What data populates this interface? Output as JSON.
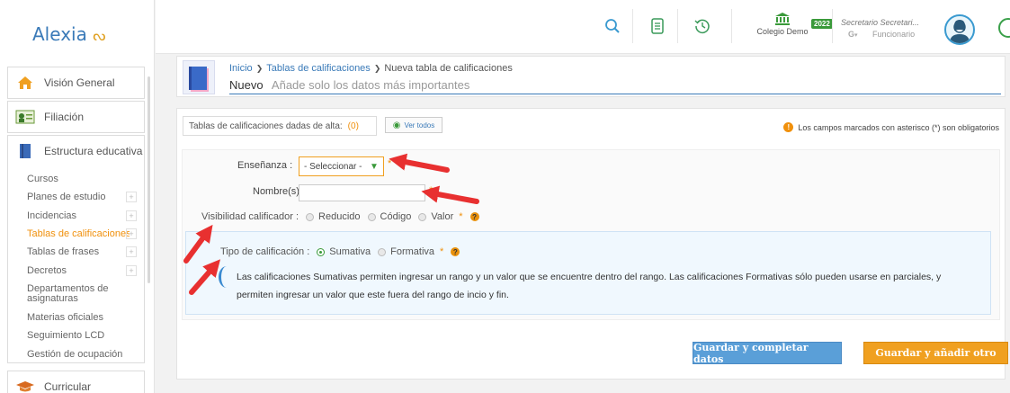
{
  "app": {
    "logo_text": "Alexia"
  },
  "sidebar": {
    "sections": [
      {
        "label": "Visión General",
        "icon": "home-icon"
      },
      {
        "label": "Filiación",
        "icon": "id-card-icon"
      },
      {
        "label": "Estructura educativa",
        "icon": "book-icon"
      },
      {
        "label": "Curricular",
        "icon": "graduation-cap-icon"
      }
    ],
    "sub_items": [
      {
        "label": "Cursos"
      },
      {
        "label": "Planes de estudio",
        "plus": "+"
      },
      {
        "label": "Incidencias",
        "plus": "+"
      },
      {
        "label": "Tablas de calificaciones",
        "plus": "+"
      },
      {
        "label": "Tablas de frases",
        "plus": "+"
      },
      {
        "label": "Decretos",
        "plus": "+"
      },
      {
        "label": "Departamentos de asignaturas"
      },
      {
        "label": "Materias oficiales"
      },
      {
        "label": "Seguimiento LCD"
      },
      {
        "label": "Gestión de ocupación"
      }
    ]
  },
  "header": {
    "school_name": "Colegio Demo",
    "year": "2022",
    "user_name": "Secretario Secretari...",
    "user_role": "Funcionario",
    "role_icon_text": "G",
    "colors": {
      "accent": "#3a9ad0",
      "brand_green": "#3a9a3a"
    }
  },
  "breadcrumb": {
    "home": "Inicio",
    "section": "Tablas de calificaciones",
    "current": "Nueva tabla de calificaciones",
    "separator": "❯"
  },
  "page": {
    "title": "Nuevo",
    "subtitle": "Añade solo los datos más importantes"
  },
  "panel": {
    "count_label": "Tablas de calificaciones dadas de alta:",
    "count_value": "(0)",
    "view_all": "Ver todos",
    "required_note": "Los campos marcados con asterisco (*) son obligatorios",
    "info_dot": "!"
  },
  "form": {
    "ensenanza_label": "Enseñanza :",
    "ensenanza_value": "- Seleccionar -",
    "nombre_label": "Nombre(s):",
    "nombre_value": "",
    "asterisk": "*",
    "visibilidad_label": "Visibilidad calificador :",
    "visibilidad_options": [
      "Reducido",
      "Código",
      "Valor"
    ],
    "tipo_label": "Tipo de calificación :",
    "tipo_options": [
      "Sumativa",
      "Formativa"
    ],
    "help_mark": "?",
    "info_text": "Las calificaciones Sumativas permiten ingresar un rango y un valor que se encuentre dentro del rango. Las calificaciones Formativas sólo pueden usarse en parciales, y permiten ingresar un valor que este fuera del rango de incio y fin."
  },
  "buttons": {
    "save_complete": "Guardar y completar datos",
    "save_add": "Guardar y añadir otro"
  }
}
